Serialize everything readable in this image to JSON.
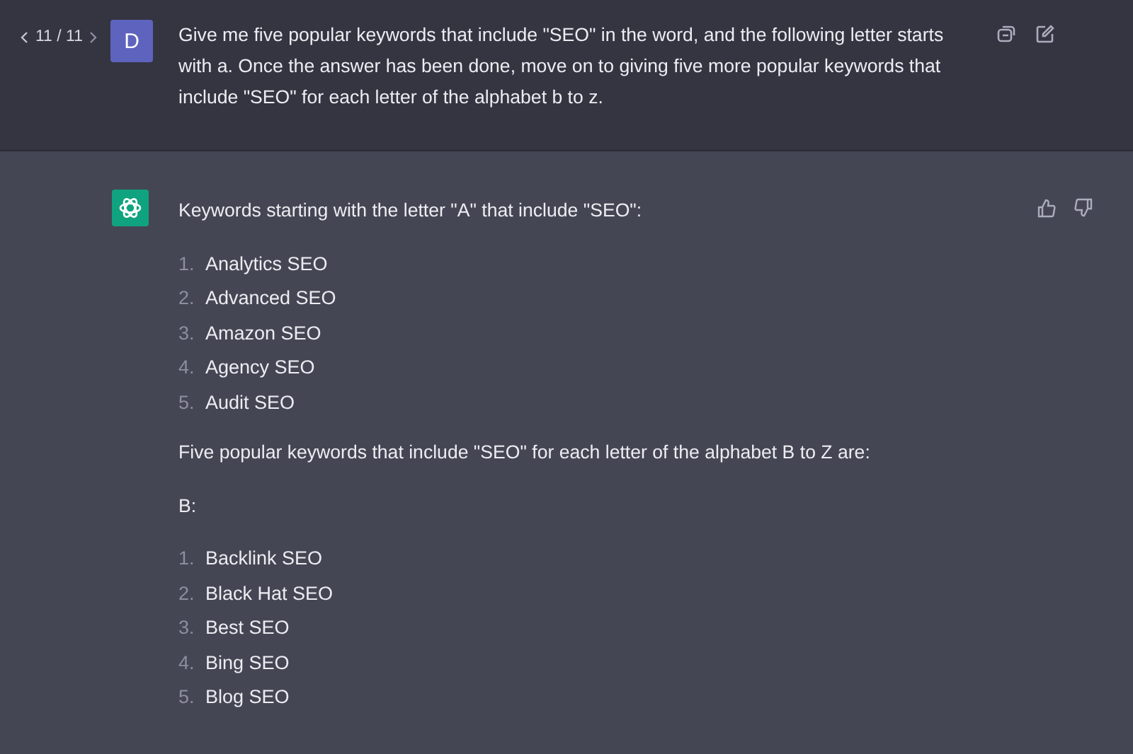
{
  "user_message": {
    "pager": "11 / 11",
    "avatar": "D",
    "text": "Give me five popular keywords that include \"SEO\" in the word, and the following letter starts with a. Once the answer has been done, move on to giving five more popular keywords that include \"SEO\" for each letter of the alphabet b to z."
  },
  "assistant_message": {
    "blocks": [
      {
        "kind": "paragraph",
        "text": "Keywords starting with the letter \"A\" that include \"SEO\":"
      },
      {
        "kind": "list",
        "items": [
          {
            "number": "1.",
            "text": "Analytics SEO"
          },
          {
            "number": "2.",
            "text": "Advanced SEO"
          },
          {
            "number": "3.",
            "text": "Amazon SEO"
          },
          {
            "number": "4.",
            "text": "Agency SEO"
          },
          {
            "number": "5.",
            "text": "Audit SEO"
          }
        ]
      },
      {
        "kind": "paragraph",
        "text": "Five popular keywords that include \"SEO\" for each letter of the alphabet B to Z are:"
      },
      {
        "kind": "paragraph",
        "text": "B:"
      },
      {
        "kind": "list",
        "items": [
          {
            "number": "1.",
            "text": "Backlink SEO"
          },
          {
            "number": "2.",
            "text": "Black Hat SEO"
          },
          {
            "number": "3.",
            "text": "Best SEO"
          },
          {
            "number": "4.",
            "text": "Bing SEO"
          },
          {
            "number": "5.",
            "text": "Blog SEO"
          }
        ]
      }
    ]
  }
}
